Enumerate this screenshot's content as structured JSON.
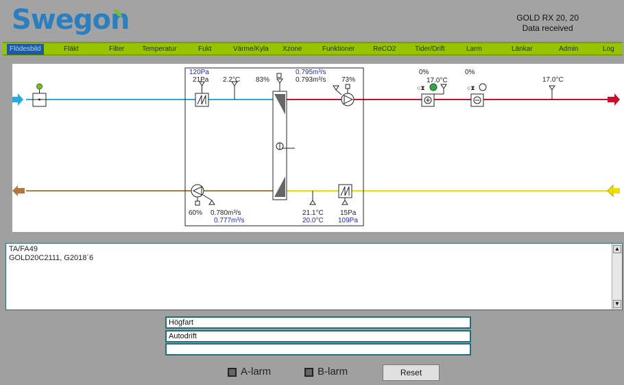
{
  "header": {
    "logo": "Swegon",
    "device_name": "GOLD RX 20, 20",
    "status": "Data received"
  },
  "nav": {
    "items": [
      "Flödesbild",
      "Fläkt",
      "Filter",
      "Temperatur",
      "Fukt",
      "Värme/Kyla",
      "Xzone",
      "Funktioner",
      "ReCO2",
      "Tider/Drift",
      "Larm",
      "Länkar",
      "Admin",
      "Log"
    ],
    "active": "Flödesbild"
  },
  "diagram": {
    "supply_pressure_set": "120Pa",
    "supply_pressure": "21Pa",
    "outdoor_temp": "2.2°C",
    "rotor_efficiency": "83%",
    "supply_flow_set": "0.795m³/s",
    "supply_flow": "0.793m³/s",
    "supply_fan_speed": "73%",
    "heating_output": "0%",
    "after_heater_temp": "17.0°C",
    "cooling_output": "0%",
    "supply_temp": "17.0°C",
    "exhaust_fan_speed": "60%",
    "exhaust_flow": "0.780m³/s",
    "exhaust_flow_set": "0.777m³/s",
    "extract_temp": "21.1°C",
    "extract_temp_set": "20.0°C",
    "extract_pressure": "15Pa",
    "extract_pressure_set": "109Pa",
    "colors": {
      "outdoor": "#29a9e0",
      "supply": "#c8102e",
      "extract": "#f0e000",
      "exhaust": "#b07a3c",
      "setpoint_text": "#1b23d6"
    }
  },
  "log": {
    "lines": [
      "TA/FA49",
      "GOLD20C2111, G2018´6"
    ]
  },
  "status_fields": [
    "Högfart",
    "Autodrift",
    ""
  ],
  "alarms": {
    "a_label": "A-larm",
    "b_label": "B-larm"
  },
  "reset_label": "Reset"
}
